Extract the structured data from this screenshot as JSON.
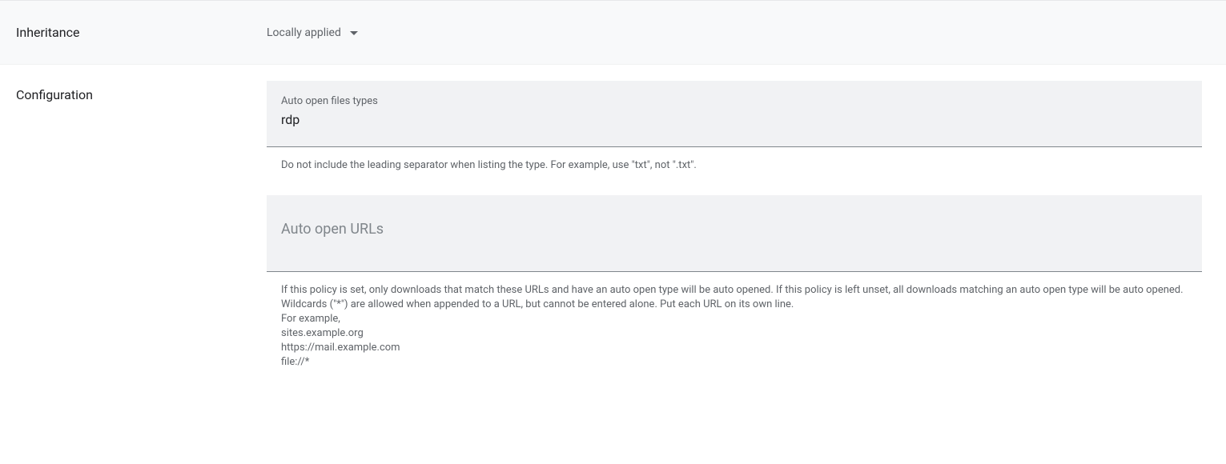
{
  "inheritance": {
    "label": "Inheritance",
    "value": "Locally applied"
  },
  "configuration": {
    "label": "Configuration",
    "autoOpenTypes": {
      "label": "Auto open files types",
      "value": "rdp",
      "helper": "Do not include the leading separator when listing the type. For example, use \"txt\", not \".txt\"."
    },
    "autoOpenUrls": {
      "placeholder": "Auto open URLs",
      "helper": "If this policy is set, only downloads that match these URLs and have an auto open type will be auto opened. If this policy is left unset, all downloads matching an auto open type will be auto opened.\nWildcards (\"*\") are allowed when appended to a URL, but cannot be entered alone. Put each URL on its own line.\nFor example,\nsites.example.org\nhttps://mail.example.com\nfile://*"
    }
  }
}
